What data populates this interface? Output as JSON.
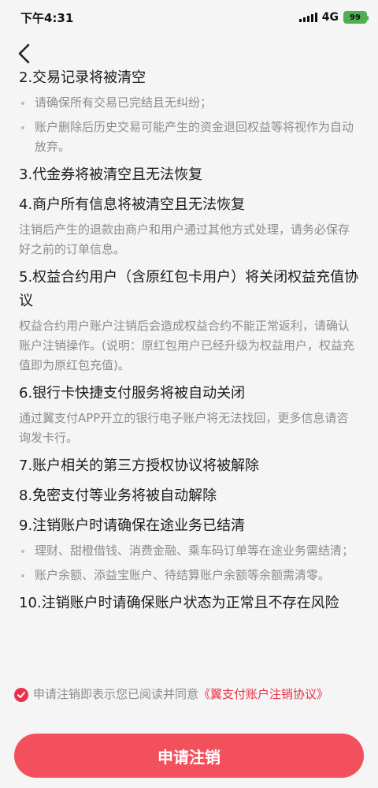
{
  "status_bar": {
    "time": "下午4:31",
    "network": "4G",
    "battery": "99"
  },
  "sections": {
    "s2": {
      "title": "2.交易记录将被清空",
      "bullets": [
        "请确保所有交易已完结且无纠纷；",
        "账户删除后历史交易可能产生的资金退回权益等将视作为自动放弃。"
      ]
    },
    "s3": {
      "title": "3.代金券将被清空且无法恢复"
    },
    "s4": {
      "title": "4.商户所有信息将被清空且无法恢复",
      "desc": "注销后产生的退款由商户和用户通过其他方式处理，请务必保存好之前的订单信息。"
    },
    "s5": {
      "title": "5.权益合约用户（含原红包卡用户）将关闭权益充值协议",
      "desc": "权益合约用户账户注销后会造成权益合约不能正常返利，请确认账户注销操作。(说明：原红包用户已经升级为权益用户，权益充值即为原红包充值)。"
    },
    "s6": {
      "title": "6.银行卡快捷支付服务将被自动关闭",
      "desc": "通过翼支付APP开立的银行电子账户将无法找回，更多信息请咨询发卡行。"
    },
    "s7": {
      "title": "7.账户相关的第三方授权协议将被解除"
    },
    "s8": {
      "title": "8.免密支付等业务将被自动解除"
    },
    "s9": {
      "title": "9.注销账户时请确保在途业务已结清",
      "bullets": [
        "理财、甜橙借钱、消费金融、乘车码订单等在途业务需结清；",
        "账户余额、添益宝账户、待结算账户余额等余额需清零。"
      ]
    },
    "s10": {
      "title": "10.注销账户时请确保账户状态为正常且不存在风险"
    }
  },
  "agreement": {
    "prefix": "申请注销即表示您已阅读并同意",
    "link": "《翼支付账户注销协议》"
  },
  "apply_button": "申请注销",
  "colors": {
    "accent": "#e8334a",
    "button": "#f2505c"
  }
}
